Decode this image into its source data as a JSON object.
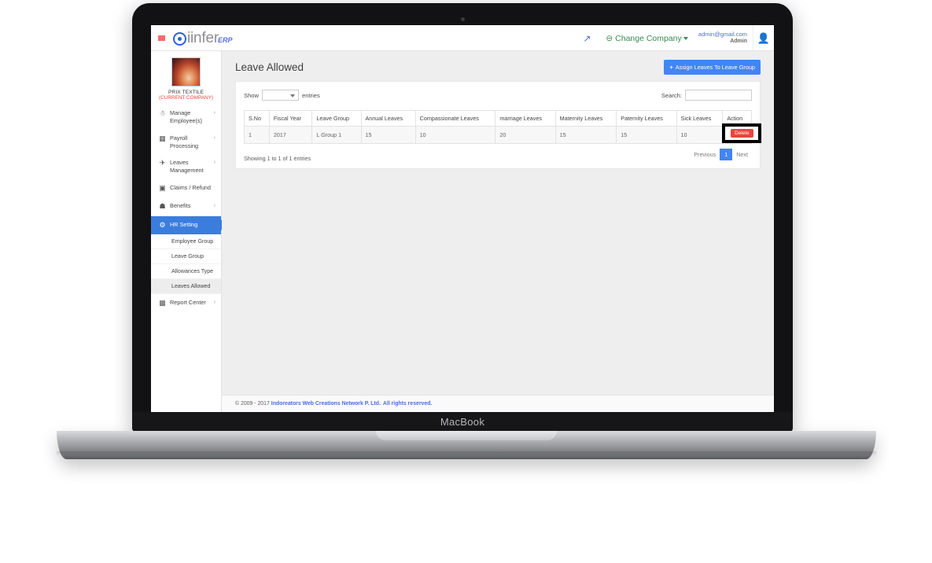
{
  "device": {
    "label": "MacBook"
  },
  "topbar": {
    "menu_icon": "hamburger-icon",
    "brand_name": "iinfer",
    "brand_suffix": "ERP",
    "expand_icon": "↗",
    "change_company": "Change Company",
    "user_email": "admin@gmail.com",
    "user_role": "Admin",
    "avatar_icon": "user-icon"
  },
  "sidebar": {
    "company_name": "PRIX TEXTILE",
    "company_status": "(CURRENT COMPANY)",
    "items": [
      {
        "label": "Manage Employee(s)",
        "icon": "⚇",
        "chevron": "›"
      },
      {
        "label": "Payroll Processing",
        "icon": "▤",
        "chevron": "›"
      },
      {
        "label": "Leaves Management",
        "icon": "✈",
        "chevron": "›"
      },
      {
        "label": "Claims / Refund",
        "icon": "⊡",
        "chevron": ""
      },
      {
        "label": "Benefits",
        "icon": "🎁",
        "chevron": "›"
      },
      {
        "label": "HR Setting",
        "icon": "✿",
        "chevron": "",
        "active": true
      },
      {
        "label": "Report Center",
        "icon": "▦",
        "chevron": "›"
      }
    ],
    "sub_items": [
      {
        "label": "Employee Group"
      },
      {
        "label": "Leave Group"
      },
      {
        "label": "Allowances Type"
      },
      {
        "label": "Leaves Allowed",
        "current": true
      }
    ]
  },
  "page": {
    "title": "Leave Allowed",
    "assign_button": "Assign Leaves To Leave Group",
    "assign_button_plus": "+"
  },
  "table_controls": {
    "show_label": "Show",
    "entries_label": "entries",
    "length_value": "",
    "search_label": "Search:",
    "search_value": "",
    "search_placeholder": ""
  },
  "chart_data": {
    "type": "table",
    "title": "Leave Allowed",
    "columns": [
      "S.No",
      "Fiscal Year",
      "Leave Group",
      "Annual Leaves",
      "Compassionate Leaves",
      "marriage Leaves",
      "Maternity Leaves",
      "Paternity Leaves",
      "Sick Leaves",
      "Action"
    ],
    "rows": [
      [
        "1",
        "2017",
        "L Group 1",
        "15",
        "10",
        "20",
        "15",
        "15",
        "10",
        "Delete"
      ]
    ]
  },
  "table_footer": {
    "info": "Showing 1 to 1 of 1 entries",
    "previous": "Previous",
    "page": "1",
    "next": "Next"
  },
  "row_action": {
    "delete_label": "Delete"
  },
  "footer": {
    "copyright": "© 2009 - 2017",
    "company_link": "Indoreators Web Creations Network P. Ltd.",
    "rights": "All rights reserved."
  },
  "colors": {
    "primary": "#4285f4",
    "sidebar_active": "#3b7ddd",
    "danger": "#e8453c",
    "company_status": "#e8453c",
    "link": "#4a6fd8",
    "change_company": "#3a8a4e",
    "highlight_box": "#000000"
  }
}
